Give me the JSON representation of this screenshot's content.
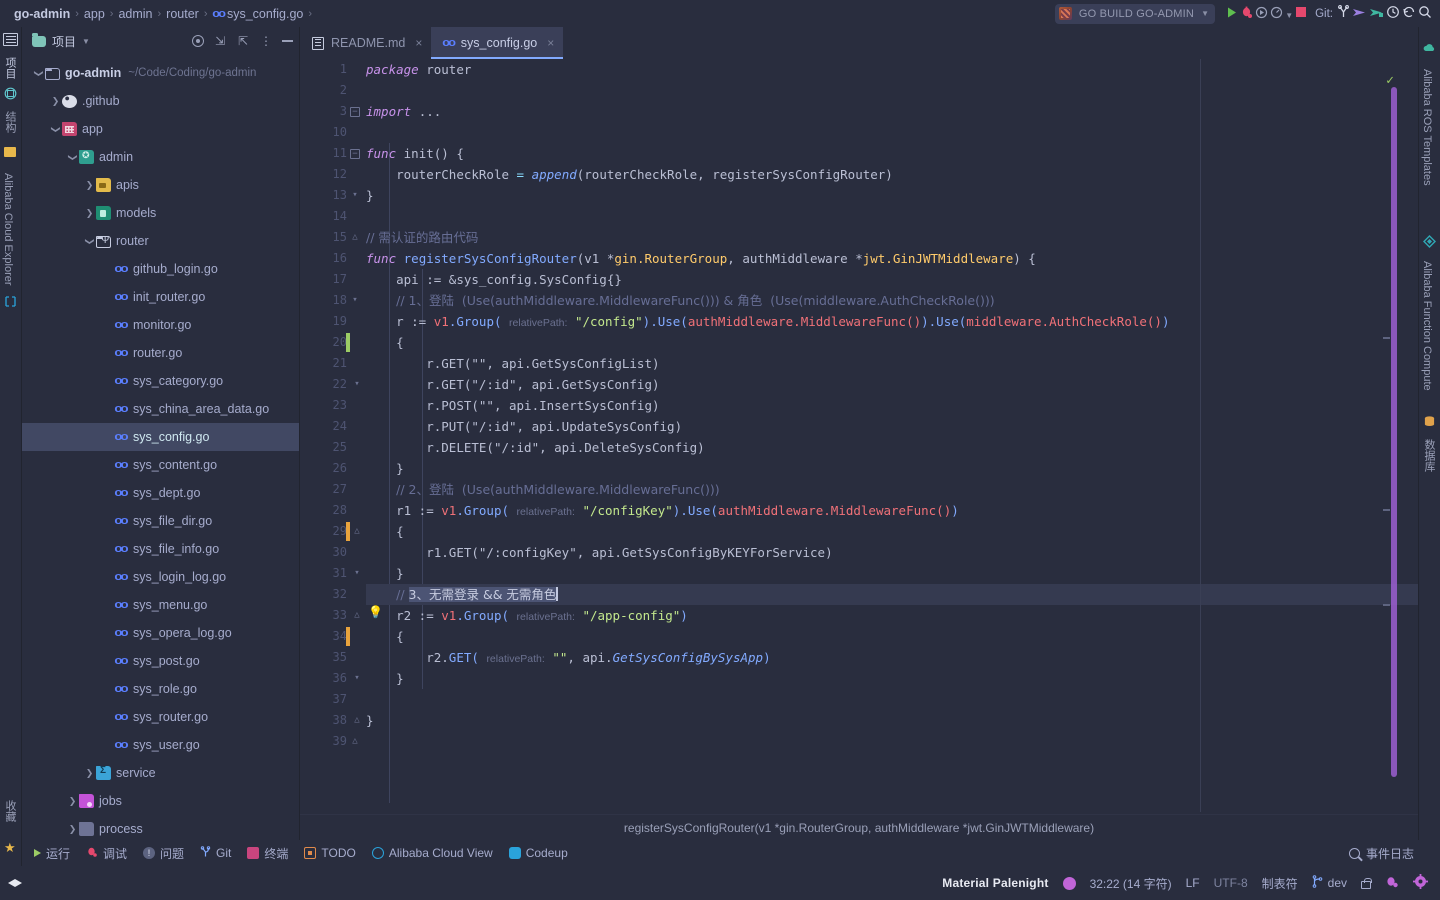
{
  "breadcrumb": {
    "items": [
      "go-admin",
      "app",
      "admin",
      "router",
      "sys_config.go"
    ],
    "separator": "›"
  },
  "toolbar": {
    "run_config": "GO BUILD GO-ADMIN",
    "git_label": "Git:",
    "icons": [
      "run-icon",
      "debug-icon",
      "run-with-coverage-icon",
      "profiler-icon",
      "stop-icon",
      "git-branch-icon",
      "git-push-icon",
      "git-update-icon",
      "history-icon",
      "rollback-icon",
      "search-icon"
    ]
  },
  "left_strip": {
    "items": [
      {
        "label": "项目",
        "icon": "project-icon",
        "active": true
      },
      {
        "label": "结构",
        "icon": "structure-icon",
        "active": false
      },
      {
        "label": "Alibaba Cloud Explorer",
        "icon": "cloud-icon",
        "active": false
      }
    ],
    "bottom": [
      {
        "label": "收藏",
        "icon": "star-icon"
      }
    ]
  },
  "right_strip": {
    "items": [
      {
        "label": "Alibaba ROS Templates",
        "icon": "ros-icon"
      },
      {
        "label": "Alibaba Function Compute",
        "icon": "fc-icon"
      },
      {
        "label": "数据库",
        "icon": "database-icon"
      }
    ]
  },
  "project_panel": {
    "title": "项目",
    "actions": [
      "locate-icon",
      "expand-all-icon",
      "collapse-all-icon",
      "more-options-icon",
      "hide-icon"
    ],
    "tree": [
      {
        "depth": 0,
        "arrow": "down",
        "icon": "folder-plain",
        "label": "go-admin",
        "path": "~/Code/Coding/go-admin",
        "root": true
      },
      {
        "depth": 1,
        "arrow": "right",
        "icon": "github",
        "label": ".github"
      },
      {
        "depth": 1,
        "arrow": "down",
        "icon": "app",
        "label": "app"
      },
      {
        "depth": 2,
        "arrow": "down",
        "icon": "admin",
        "label": "admin"
      },
      {
        "depth": 3,
        "arrow": "right",
        "icon": "apis",
        "label": "apis"
      },
      {
        "depth": 3,
        "arrow": "right",
        "icon": "models",
        "label": "models"
      },
      {
        "depth": 3,
        "arrow": "down",
        "icon": "router",
        "label": "router"
      },
      {
        "depth": 4,
        "arrow": "none",
        "icon": "go",
        "label": "github_login.go"
      },
      {
        "depth": 4,
        "arrow": "none",
        "icon": "go",
        "label": "init_router.go"
      },
      {
        "depth": 4,
        "arrow": "none",
        "icon": "go",
        "label": "monitor.go"
      },
      {
        "depth": 4,
        "arrow": "none",
        "icon": "go",
        "label": "router.go"
      },
      {
        "depth": 4,
        "arrow": "none",
        "icon": "go",
        "label": "sys_category.go"
      },
      {
        "depth": 4,
        "arrow": "none",
        "icon": "go",
        "label": "sys_china_area_data.go"
      },
      {
        "depth": 4,
        "arrow": "none",
        "icon": "go",
        "label": "sys_config.go",
        "selected": true
      },
      {
        "depth": 4,
        "arrow": "none",
        "icon": "go",
        "label": "sys_content.go"
      },
      {
        "depth": 4,
        "arrow": "none",
        "icon": "go",
        "label": "sys_dept.go"
      },
      {
        "depth": 4,
        "arrow": "none",
        "icon": "go",
        "label": "sys_file_dir.go"
      },
      {
        "depth": 4,
        "arrow": "none",
        "icon": "go",
        "label": "sys_file_info.go"
      },
      {
        "depth": 4,
        "arrow": "none",
        "icon": "go",
        "label": "sys_login_log.go"
      },
      {
        "depth": 4,
        "arrow": "none",
        "icon": "go",
        "label": "sys_menu.go"
      },
      {
        "depth": 4,
        "arrow": "none",
        "icon": "go",
        "label": "sys_opera_log.go"
      },
      {
        "depth": 4,
        "arrow": "none",
        "icon": "go",
        "label": "sys_post.go"
      },
      {
        "depth": 4,
        "arrow": "none",
        "icon": "go",
        "label": "sys_role.go"
      },
      {
        "depth": 4,
        "arrow": "none",
        "icon": "go",
        "label": "sys_router.go"
      },
      {
        "depth": 4,
        "arrow": "none",
        "icon": "go",
        "label": "sys_user.go"
      },
      {
        "depth": 3,
        "arrow": "right",
        "icon": "service",
        "label": "service"
      },
      {
        "depth": 2,
        "arrow": "right",
        "icon": "jobs",
        "label": "jobs"
      },
      {
        "depth": 2,
        "arrow": "right",
        "icon": "process",
        "label": "process"
      }
    ]
  },
  "editor": {
    "tabs": [
      {
        "label": "README.md",
        "icon": "markdown-icon",
        "active": false,
        "close": "×"
      },
      {
        "label": "sys_config.go",
        "icon": "go-icon",
        "active": true,
        "close": "×"
      }
    ],
    "line_numbers": [
      1,
      2,
      3,
      10,
      11,
      12,
      13,
      14,
      15,
      16,
      17,
      18,
      19,
      20,
      21,
      22,
      23,
      24,
      25,
      26,
      27,
      28,
      29,
      30,
      31,
      32,
      33,
      34,
      35,
      36,
      37,
      38,
      39
    ],
    "breadcrumb_bottom": "registerSysConfigRouter(v1 *gin.RouterGroup, authMiddleware *jwt.GinJWTMiddleware)",
    "code": {
      "l1_kw": "package",
      "l1_name": "router",
      "l3_kw": "import",
      "l3_dots": "...",
      "l11_kw": "func",
      "l11_sig": "init() {",
      "l12_a": "routerCheckRole",
      "l12_eq": "=",
      "l12_fn": "append",
      "l12_args": "(routerCheckRole, registerSysConfigRouter)",
      "l13": "}",
      "l15_cmt": "// 需认证的路由代码",
      "l16_kw": "func",
      "l16_fn": "registerSysConfigRouter",
      "l16_p1": "(v1 *",
      "l16_t1": "gin.RouterGroup",
      "l16_p2": ", authMiddleware *",
      "l16_t2": "jwt.GinJWTMiddleware",
      "l16_p3": ") {",
      "l17": "api := &sys_config.SysConfig{}",
      "l18_cmt": "// 1、登陆  (Use(authMiddleware.MiddlewareFunc())) & 角色  (Use(middleware.AuthCheckRole()))",
      "l19_a": "r := ",
      "l19_v": "v1",
      "l19_g": ".Group(",
      "l19_hint": "relativePath:",
      "l19_str": "\"/config\"",
      "l19_b": ").Use(",
      "l19_m1": "authMiddleware.MiddlewareFunc()",
      "l19_c": ").Use(",
      "l19_m2": "middleware.AuthCheckRole()",
      "l19_d": ")",
      "l20": "{",
      "l21": "r.GET(\"\", api.GetSysConfigList)",
      "l22": "r.GET(\"/:id\", api.GetSysConfig)",
      "l23": "r.POST(\"\", api.InsertSysConfig)",
      "l24": "r.PUT(\"/:id\", api.UpdateSysConfig)",
      "l25": "r.DELETE(\"/:id\", api.DeleteSysConfig)",
      "l26": "}",
      "l27_cmt": "// 2、登陆  (Use(authMiddleware.MiddlewareFunc()))",
      "l28_a": "r1 := ",
      "l28_v": "v1",
      "l28_g": ".Group(",
      "l28_hint": "relativePath:",
      "l28_str": "\"/configKey\"",
      "l28_b": ").Use(",
      "l28_m": "authMiddleware.MiddlewareFunc()",
      "l28_c": ")",
      "l29": "{",
      "l30": "r1.GET(\"/:configKey\", api.GetSysConfigByKEYForService)",
      "l31": "}",
      "l32_cmt_pre": "// ",
      "l32_cmt_sel": "3、无需登录 && 无需角色",
      "l33_a": "r2 := ",
      "l33_v": "v1",
      "l33_g": ".Group(",
      "l33_hint": "relativePath:",
      "l33_str": "\"/app-config\"",
      "l33_b": ")",
      "l34": "{",
      "l35_a": "r2.",
      "l35_m": "GET",
      "l35_b": "(",
      "l35_hint": "relativePath:",
      "l35_str": "\"\"",
      "l35_c": ", api.",
      "l35_f": "GetSysConfigBySysApp",
      "l35_d": ")",
      "l36": "}",
      "l38": "}"
    }
  },
  "bottom_bar": {
    "items": [
      {
        "label": "运行",
        "icon": "run-icon"
      },
      {
        "label": "调试",
        "icon": "debug-icon"
      },
      {
        "label": "问题",
        "icon": "problems-icon"
      },
      {
        "label": "Git",
        "icon": "git-icon"
      },
      {
        "label": "终端",
        "icon": "terminal-icon"
      },
      {
        "label": "TODO",
        "icon": "todo-icon"
      },
      {
        "label": "Alibaba Cloud View",
        "icon": "alibaba-cloud-icon"
      },
      {
        "label": "Codeup",
        "icon": "codeup-icon"
      }
    ],
    "event_log": "事件日志"
  },
  "statusbar": {
    "theme": "Material Palenight",
    "position": "32:22 (14 字符)",
    "line_sep": "LF",
    "encoding": "UTF-8",
    "indent": "制表符",
    "branch": "dev",
    "icons": [
      "lock-icon",
      "inspection-icon",
      "settings-icon"
    ]
  },
  "colors": {
    "bg": "#292D3E",
    "accent": "#82AAFF",
    "selection": "#4C5474",
    "string": "#C3E88D",
    "keyword": "#C792EA",
    "comment": "#676E95",
    "type": "#FFCB6B",
    "theme_dot": "#C165D8",
    "scrollbar": "#9B5FD0"
  }
}
